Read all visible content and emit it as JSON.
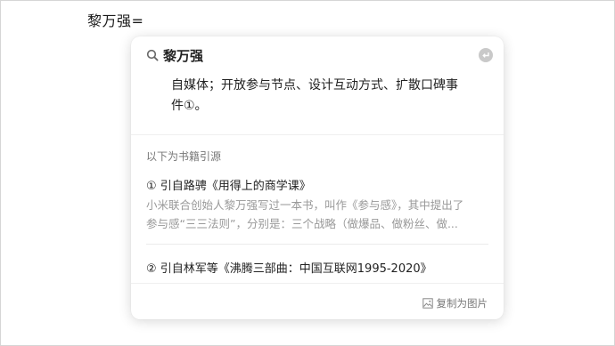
{
  "document": {
    "text": "黎万强="
  },
  "popup": {
    "search": {
      "query": "黎万强"
    },
    "definition": {
      "line1": "自媒体；开放参与节点、设计互动方式、扩散口碑事",
      "line2": "件①。"
    },
    "sources": {
      "header": "以下为书籍引源",
      "items": [
        {
          "title": "① 引自路骋《用得上的商学课》",
          "snippet_line1": "小米联合创始人黎万强写过一本书，叫作《参与感》，其中提出了",
          "snippet_line2": "参与感“三三法则”，分别是：三个战略（做爆品、做粉丝、做..."
        },
        {
          "title": "② 引自林军等《沸腾三部曲：中国互联网1995-2020》"
        }
      ]
    },
    "footer": {
      "copy_label": "复制为图片",
      "copy_icon": "image-icon"
    }
  }
}
